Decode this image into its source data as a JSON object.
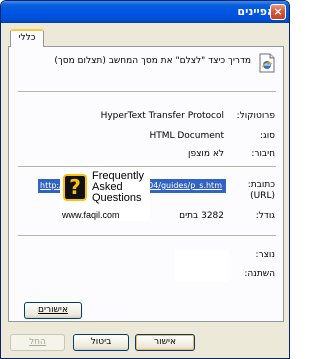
{
  "window": {
    "title": "מאפיינים",
    "close_glyph": "×"
  },
  "tab": {
    "label": "כללי"
  },
  "document": {
    "icon": "document-ie-icon",
    "title": "מדריך כיצד \"לצלם\" את מסך המחשב (תצלום מסך)"
  },
  "properties": {
    "protocol_label": "פרוטוקול:",
    "protocol_value": "HyperText Transfer Protocol",
    "type_label": "סוג:",
    "type_value": "HTML Document",
    "connected_label": "חיבור:",
    "connected_value": "לא מוצפן",
    "address_label": "כתובת:",
    "address_label_sub": "(URL)",
    "address_value_start": "http://",
    "address_value_end": "004/guides/p_s.htm",
    "size_label": "גודל:",
    "size_value": "3282 בתים",
    "created_label": "נוצר:",
    "modified_label": "השתנה:"
  },
  "watermark": {
    "badge_glyph": "?",
    "line1": "Frequently",
    "line2": "Asked",
    "line3": "Questions",
    "url": "www.faqil.com"
  },
  "buttons": {
    "certificates": "אישורים",
    "ok": "אישור",
    "cancel": "ביטול",
    "apply": "החל"
  }
}
